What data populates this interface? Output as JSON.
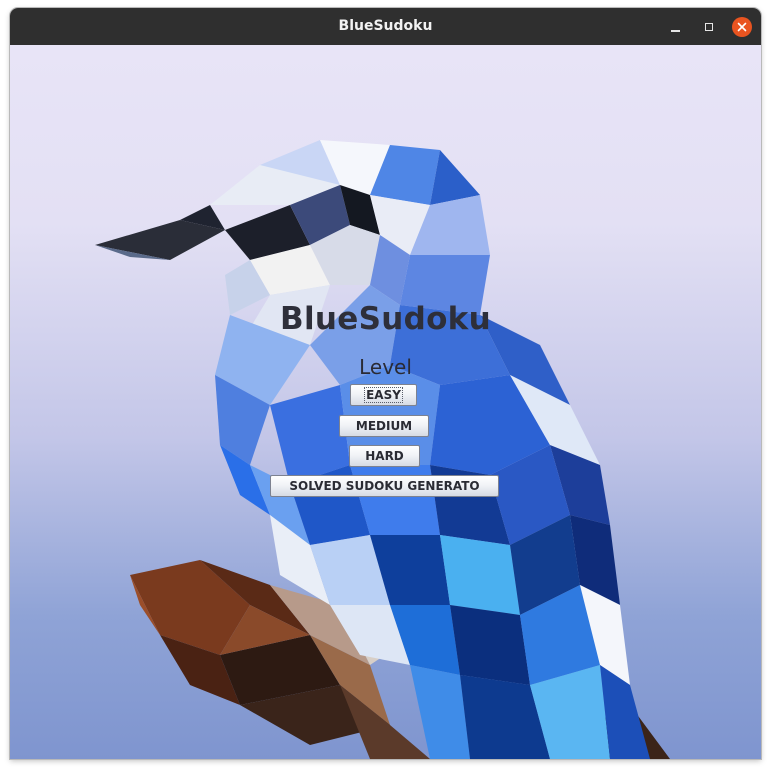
{
  "window": {
    "title": "BlueSudoku",
    "controls": {
      "minimize_icon": "minimize-icon",
      "maximize_icon": "maximize-icon",
      "close_icon": "close-icon"
    },
    "close_color": "#e95420",
    "titlebar_color": "#2f2f2f"
  },
  "main": {
    "heading": "BlueSudoku",
    "level_label": "Level",
    "buttons": {
      "easy": "EASY",
      "medium": "MEDIUM",
      "hard": "HARD",
      "generator": "SOLVED SUDOKU GENERATO"
    },
    "background": {
      "illustration": "low-poly blue jay bird on branch",
      "colors": {
        "sky_top": "#e8e4f7",
        "sky_bottom": "#7f95cf",
        "bird_blue": "#3f73d9",
        "branch_brown": "#6b3a22"
      }
    }
  }
}
